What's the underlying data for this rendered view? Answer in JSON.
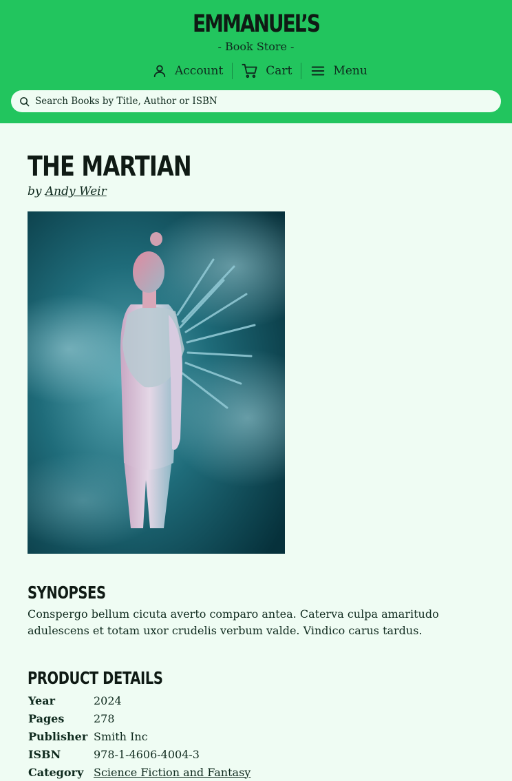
{
  "header": {
    "brand": "EMMANUEL’S",
    "tagline": "- Book Store -"
  },
  "nav": {
    "items": [
      {
        "label": "Account",
        "icon": "user-icon"
      },
      {
        "label": "Cart",
        "icon": "cart-icon"
      },
      {
        "label": "Menu",
        "icon": "menu-icon"
      }
    ]
  },
  "search": {
    "placeholder": "Search Books by Title, Author or ISBN",
    "icon": "search-icon"
  },
  "book": {
    "title": "The Martian",
    "by": "by",
    "author": "Andy Weir"
  },
  "synopsis": {
    "heading": "Synopses",
    "text": "Conspergo bellum cicuta averto comparo antea. Caterva culpa amaritudo adulescens et totam uxor crudelis verbum valde. Vindico carus tardus."
  },
  "details": {
    "heading": "Product Details",
    "rows": [
      {
        "label": "Year",
        "value": "2024"
      },
      {
        "label": "Pages",
        "value": "278"
      },
      {
        "label": "Publisher",
        "value": "Smith Inc"
      },
      {
        "label": "ISBN",
        "value": "978-1-4606-4004-3"
      },
      {
        "label": "Category",
        "value": "Science Fiction and Fantasy"
      }
    ]
  },
  "colors": {
    "header_bg": "#22c55e",
    "page_bg": "#effcf3",
    "text": "#0f2a1e"
  }
}
